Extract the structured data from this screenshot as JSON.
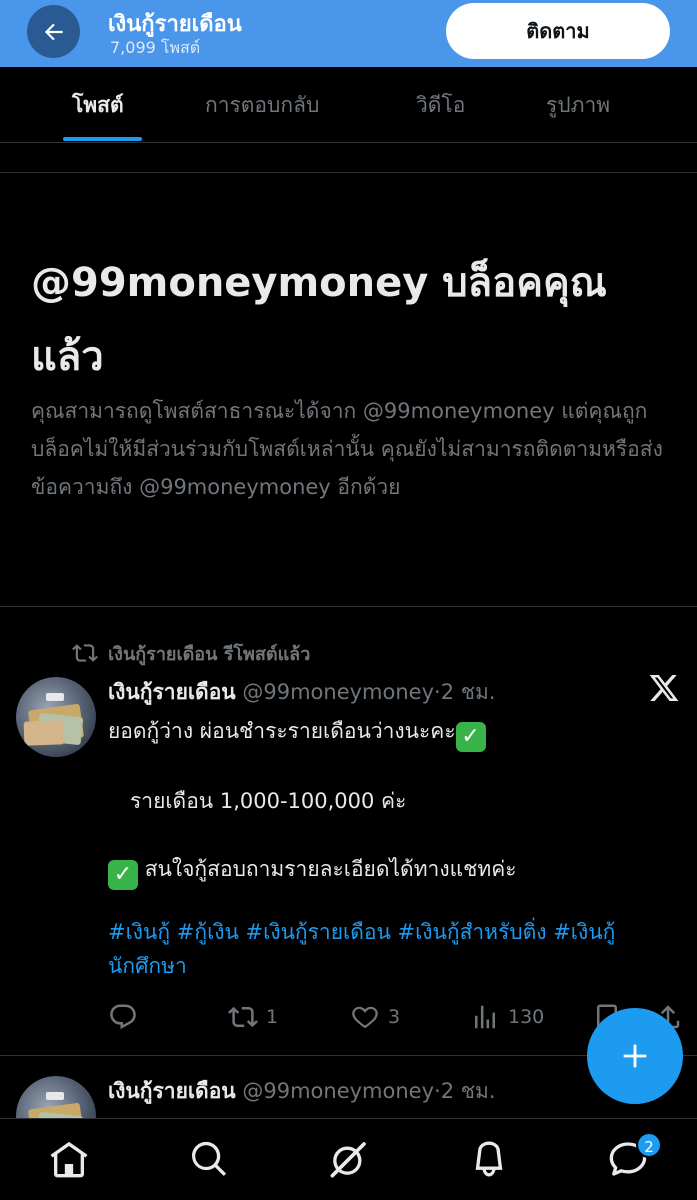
{
  "header": {
    "account_name": "เงินกู้รายเดือน",
    "post_count": "7,099 โพสต์",
    "follow_label": "ติดตาม"
  },
  "tabs": [
    {
      "label": "โพสต์",
      "active": true
    },
    {
      "label": "การตอบกลับ",
      "active": false
    },
    {
      "label": "วิดีโอ",
      "active": false
    },
    {
      "label": "รูปภาพ",
      "active": false
    }
  ],
  "blocked": {
    "title": "@99moneymoney บล็อคคุณแล้ว",
    "description": "คุณสามารถดูโพสต์สาธารณะได้จาก @99moneymoney แต่คุณถูกบล็อคไม่ให้มีส่วนร่วมกับโพสต์เหล่านั้น คุณยังไม่สามารถติดตามหรือส่งข้อความถึง @99moneymoney อีกด้วย"
  },
  "post": {
    "repost_label": "เงินกู้รายเดือน รีโพสต์แล้ว",
    "author": "เงินกู้รายเดือน",
    "handle": "@99moneymoney",
    "dot": "·",
    "time": "2 ชม.",
    "line1": "ยอดกู้ว่าง  ผ่อนชำระรายเดือนว่างนะคะ",
    "line2": "รายเดือน 1,000-100,000 ค่ะ",
    "line3": "สนใจกู้สอบถามรายละเอียดได้ทางแชทค่ะ",
    "check_glyph": "✓",
    "hashtags": "#เงินกู้ #กู้เงิน #เงินกู้รายเดือน #เงินกู้สำหรับติ่ง #เงินกู้นักศึกษา",
    "stats": {
      "replies": "",
      "reposts": "1",
      "likes": "3",
      "views": "130"
    }
  },
  "second_post": {
    "author": "เงินกู้รายเดือน",
    "handle": "@99moneymoney",
    "dot": "·",
    "time": "2 ชม."
  },
  "nav": {
    "messages_badge": "2"
  },
  "icons": [
    "back-arrow-icon",
    "repost-icon",
    "x-logo-icon",
    "reply-icon",
    "retweet-icon",
    "like-icon",
    "views-icon",
    "bookmark-icon",
    "share-icon",
    "compose-plus-icon",
    "home-icon",
    "search-icon",
    "grok-icon",
    "bell-icon",
    "messages-icon"
  ],
  "colors": {
    "header_bg": "#4a96ea",
    "accent": "#1d9bf0",
    "muted": "#71767b",
    "text": "#e7e9ea",
    "background": "#000000"
  }
}
